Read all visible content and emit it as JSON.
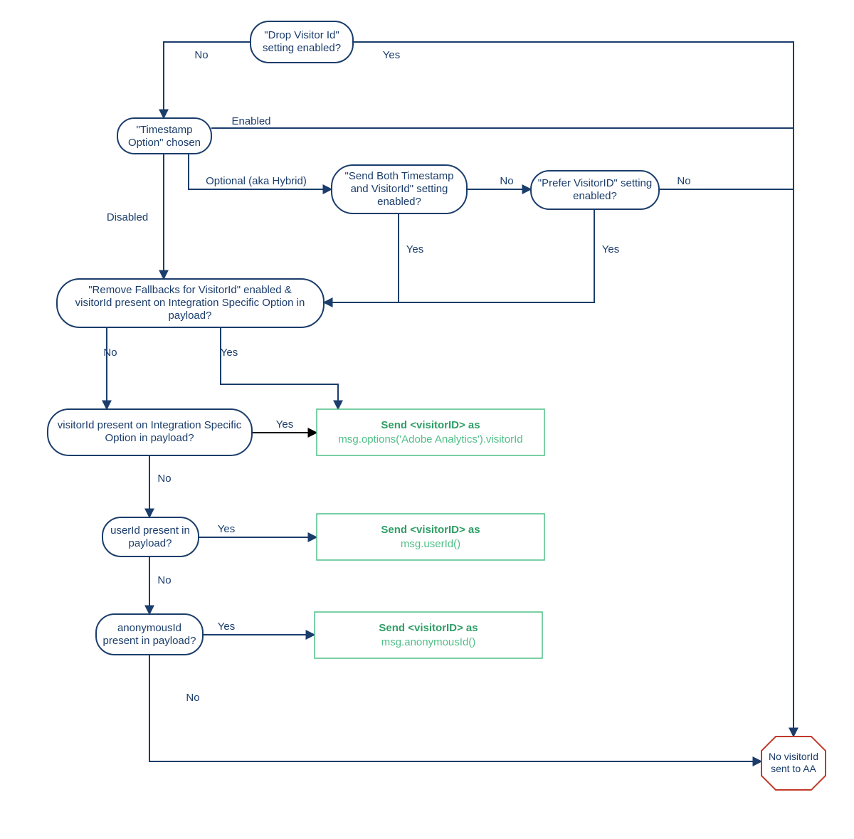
{
  "nodes": {
    "drop_visitor": {
      "line1": "\"Drop Visitor Id\"",
      "line2": "setting enabled?"
    },
    "timestamp_option": {
      "line1": "\"Timestamp",
      "line2": "Option\" chosen"
    },
    "send_both": {
      "line1": "\"Send Both Timestamp",
      "line2": "and VisitorId\" setting",
      "line3": "enabled?"
    },
    "prefer_visitor": {
      "line1": "\"Prefer VisitorID\" setting",
      "line2": "enabled?"
    },
    "remove_fallbacks": {
      "line1": "\"Remove Fallbacks for VisitorId\" enabled &",
      "line2": "visitorId present on Integration Specific Option in",
      "line3": "payload?"
    },
    "visitorid_present": {
      "line1": "visitorId present on Integration Specific",
      "line2": "Option in payload?"
    },
    "userid_present": {
      "line1": "userId present in",
      "line2": "payload?"
    },
    "anonid_present": {
      "line1": "anonymousId",
      "line2": "present in payload?"
    },
    "result_visitor": {
      "line1": "Send <visitorID> as",
      "line2": "msg.options('Adobe Analytics').visitorId"
    },
    "result_user": {
      "line1": "Send <visitorID>  as",
      "line2": "msg.userId()"
    },
    "result_anon": {
      "line1": "Send <visitorID> as",
      "line2": "msg.anonymousId()"
    },
    "stop": {
      "line1": "No visitorId",
      "line2": "sent to AA"
    }
  },
  "edges": {
    "no": "No",
    "yes": "Yes",
    "enabled": "Enabled",
    "disabled": "Disabled",
    "optional": "Optional (aka Hybrid)"
  }
}
